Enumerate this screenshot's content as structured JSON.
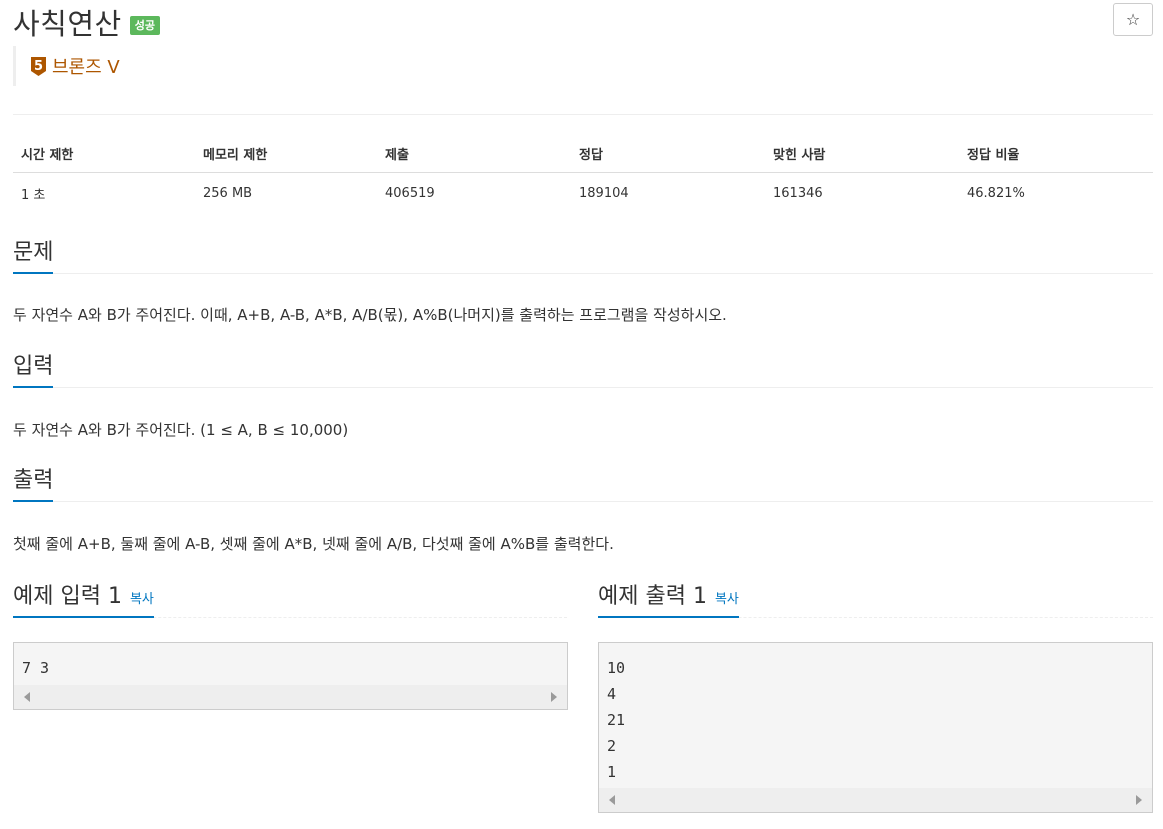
{
  "problem": {
    "title": "사칙연산",
    "status_badge": "성공",
    "star": "☆",
    "tier": {
      "level": "5",
      "label": "브론즈 V",
      "color": "#ad5600"
    }
  },
  "info_table": {
    "headers": [
      "시간 제한",
      "메모리 제한",
      "제출",
      "정답",
      "맞힌 사람",
      "정답 비율"
    ],
    "values": [
      "1 초",
      "256 MB",
      "406519",
      "189104",
      "161346",
      "46.821%"
    ]
  },
  "sections": {
    "problem": {
      "heading": "문제",
      "text": "두 자연수 A와 B가 주어진다. 이때, A+B, A-B, A*B, A/B(몫), A%B(나머지)를 출력하는 프로그램을 작성하시오."
    },
    "input": {
      "heading": "입력",
      "text": "두 자연수 A와 B가 주어진다. (1 ≤ A, B ≤ 10,000)"
    },
    "output": {
      "heading": "출력",
      "text": "첫째 줄에 A+B, 둘째 줄에 A-B, 셋째 줄에 A*B, 넷째 줄에 A/B, 다섯째 줄에 A%B를 출력한다."
    }
  },
  "samples": {
    "input": {
      "heading": "예제 입력 1",
      "copy_label": "복사",
      "lines": [
        "7 3"
      ]
    },
    "output": {
      "heading": "예제 출력 1",
      "copy_label": "복사",
      "lines": [
        "10",
        "4",
        "21",
        "2",
        "1"
      ]
    }
  },
  "colors": {
    "accent": "#0076c0",
    "success": "#5cb85c",
    "bronze": "#ad5600"
  }
}
